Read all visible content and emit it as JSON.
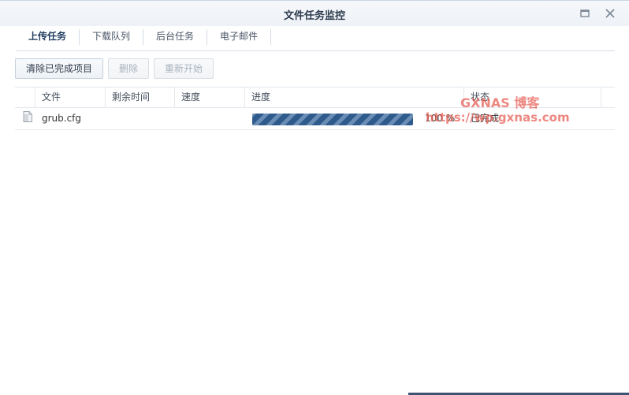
{
  "window": {
    "title": "文件任务监控"
  },
  "icons": {
    "maximize": "maximize-icon",
    "close": "close-icon",
    "file": "file-icon"
  },
  "tabs": [
    {
      "label": "上传任务",
      "active": true
    },
    {
      "label": "下载队列",
      "active": false
    },
    {
      "label": "后台任务",
      "active": false
    },
    {
      "label": "电子邮件",
      "active": false
    }
  ],
  "toolbar": {
    "clear_completed": "清除已完成项目",
    "delete": "删除",
    "restart": "重新开始"
  },
  "table": {
    "columns": [
      "文件",
      "剩余时间",
      "速度",
      "进度",
      "状态"
    ],
    "rows": [
      {
        "file": "grub.cfg",
        "remaining": "",
        "speed": "",
        "progress": 100,
        "progress_text": "100 %",
        "status": "已完成"
      }
    ]
  },
  "watermark": {
    "line1": "GXNAS 博客",
    "line2": "https://wp.gxnas.com"
  },
  "colors": {
    "progress": "#2f5a8c",
    "progress_stripe": "#6a8db5",
    "watermark": "#e65a50",
    "title": "#2b3a4d"
  }
}
